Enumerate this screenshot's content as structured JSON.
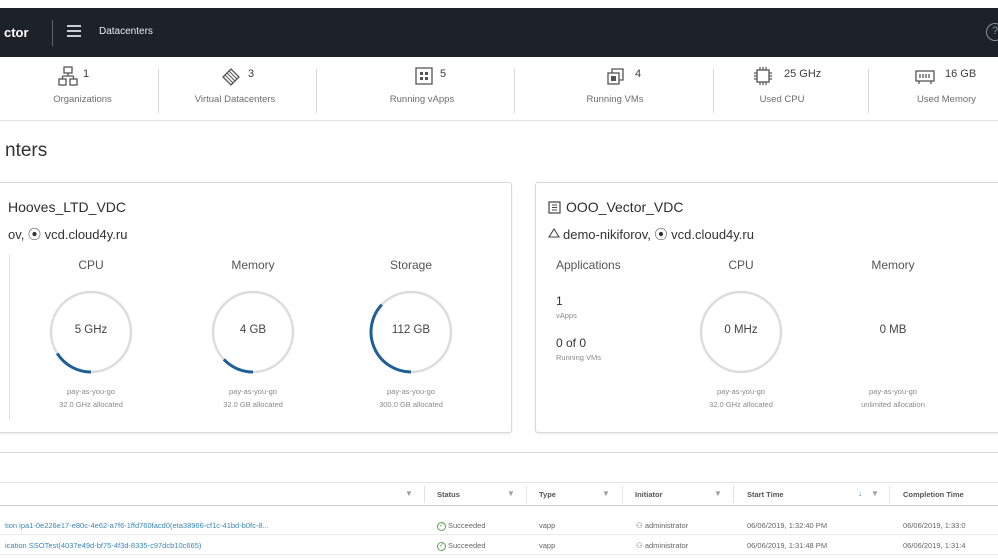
{
  "header": {
    "app_name": "ctor",
    "nav_title": "Datacenters",
    "help_glyph": "?"
  },
  "stats": [
    {
      "icon": "organizations-icon",
      "value": "1",
      "label": "Organizations"
    },
    {
      "icon": "virtual-datacenters-icon",
      "value": "3",
      "label": "Virtual Datacenters"
    },
    {
      "icon": "running-vapps-icon",
      "value": "5",
      "label": "Running vApps"
    },
    {
      "icon": "running-vms-icon",
      "value": "4",
      "label": "Running VMs"
    },
    {
      "icon": "cpu-icon",
      "value": "25 GHz",
      "label": "Used CPU"
    },
    {
      "icon": "memory-icon",
      "value": "16 GB",
      "label": "Used Memory"
    }
  ],
  "section_title": "nters",
  "cards": [
    {
      "title": "Hooves_LTD_VDC",
      "subtitle": "ov,  ⦿ vcd.cloud4y.ru",
      "metrics": [
        {
          "label": "CPU",
          "value": "5 GHz",
          "plan": "pay-as-you-go",
          "allocated": "32.0 GHz allocated",
          "fraction": 0.16
        },
        {
          "label": "Memory",
          "value": "4 GB",
          "plan": "pay-as-you-go",
          "allocated": "32.0 GB allocated",
          "fraction": 0.13
        },
        {
          "label": "Storage",
          "value": "112 GB",
          "plan": "pay-as-you-go",
          "allocated": "300.0 GB allocated",
          "fraction": 0.37
        }
      ]
    },
    {
      "title": "OOO_Vector_VDC",
      "subtitle": "demo-nikiforov,  ⦿ vcd.cloud4y.ru",
      "applications": {
        "label": "Applications",
        "vapps_count": "1",
        "vapps_label": "vApps",
        "vms_count": "0 of 0",
        "vms_label": "Running VMs"
      },
      "metrics": [
        {
          "label": "CPU",
          "value": "0 MHz",
          "plan": "pay-as-you-go",
          "allocated": "32.0 GHz allocated",
          "fraction": 0
        },
        {
          "label": "Memory",
          "value": "0 MB",
          "plan": "pay-as-you-go",
          "allocated": "unlimited allocation",
          "fraction": 0
        }
      ]
    }
  ],
  "table": {
    "columns": [
      "Status",
      "Type",
      "Initiator",
      "Start Time",
      "Completion Time"
    ],
    "rows": [
      {
        "name": "tion ipa1-0e226e17-e80c-4e62-a7f6-1ffd760facd0(eta38966-cf1c-41bd-b0fc-8...",
        "status": "Succeeded",
        "type": "vapp",
        "initiator": "administrator",
        "start": "06/06/2019, 1:32:40 PM",
        "end": "06/06/2019, 1:33:0"
      },
      {
        "name": "ication SSOTest(4037e49d-bf75-4f3d-8335-c97dcb10c665)",
        "status": "Succeeded",
        "type": "vapp",
        "initiator": "administrator",
        "start": "06/06/2019, 1:31:48 PM",
        "end": "06/06/2019, 1:31:4"
      }
    ]
  },
  "colors": {
    "topbar": "#1c2228",
    "gauge_track": "#dddddd",
    "gauge_fill": "#1f5f94",
    "link": "#3a87b8",
    "success": "#5ca34f"
  }
}
